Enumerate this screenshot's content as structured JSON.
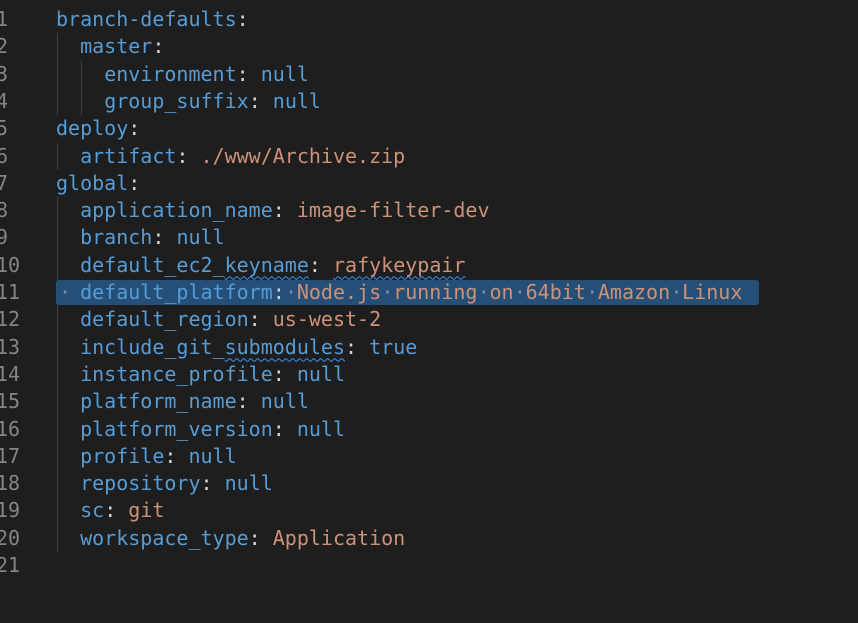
{
  "editor": {
    "language": "yaml",
    "selected_line": 11,
    "lines": [
      {
        "n": "1",
        "indent": 0,
        "key": "branch-defaults",
        "value": "",
        "vtype": ""
      },
      {
        "n": "2",
        "indent": 1,
        "key": "master",
        "value": "",
        "vtype": ""
      },
      {
        "n": "3",
        "indent": 2,
        "key": "environment",
        "value": "null",
        "vtype": "null"
      },
      {
        "n": "4",
        "indent": 2,
        "key": "group_suffix",
        "value": "null",
        "vtype": "null"
      },
      {
        "n": "5",
        "indent": 0,
        "key": "deploy",
        "value": "",
        "vtype": ""
      },
      {
        "n": "6",
        "indent": 1,
        "key": "artifact",
        "value": "./www/Archive.zip",
        "vtype": "str"
      },
      {
        "n": "7",
        "indent": 0,
        "key": "global",
        "value": "",
        "vtype": ""
      },
      {
        "n": "8",
        "indent": 1,
        "key": "application_name",
        "value": "image-filter-dev",
        "vtype": "str"
      },
      {
        "n": "9",
        "indent": 1,
        "key": "branch",
        "value": "null",
        "vtype": "null"
      },
      {
        "n": "10",
        "indent": 1,
        "key": "default_ec2_keyname",
        "value": "rafykeypair",
        "vtype": "str",
        "squiggle_key_part": "keyname",
        "squiggle_value": true
      },
      {
        "n": "11",
        "indent": 1,
        "key": "default_platform",
        "value": "Node.js running on 64bit Amazon Linux",
        "vtype": "str"
      },
      {
        "n": "12",
        "indent": 1,
        "key": "default_region",
        "value": "us-west-2",
        "vtype": "str"
      },
      {
        "n": "13",
        "indent": 1,
        "key": "include_git_submodules",
        "value": "true",
        "vtype": "null",
        "squiggle_key_part": "submodules"
      },
      {
        "n": "14",
        "indent": 1,
        "key": "instance_profile",
        "value": "null",
        "vtype": "null"
      },
      {
        "n": "15",
        "indent": 1,
        "key": "platform_name",
        "value": "null",
        "vtype": "null"
      },
      {
        "n": "16",
        "indent": 1,
        "key": "platform_version",
        "value": "null",
        "vtype": "null"
      },
      {
        "n": "17",
        "indent": 1,
        "key": "profile",
        "value": "null",
        "vtype": "null"
      },
      {
        "n": "18",
        "indent": 1,
        "key": "repository",
        "value": "null",
        "vtype": "null"
      },
      {
        "n": "19",
        "indent": 1,
        "key": "sc",
        "value": "git",
        "vtype": "str"
      },
      {
        "n": "20",
        "indent": 1,
        "key": "workspace_type",
        "value": "Application",
        "vtype": "str"
      },
      {
        "n": "21",
        "indent": 0,
        "key": "",
        "value": "",
        "vtype": ""
      }
    ]
  },
  "colors": {
    "background": "#1e1e1e",
    "key": "#569cd6",
    "string": "#ce9178",
    "keyword": "#569cd6",
    "line_number": "#858585",
    "selection": "#264f78"
  }
}
